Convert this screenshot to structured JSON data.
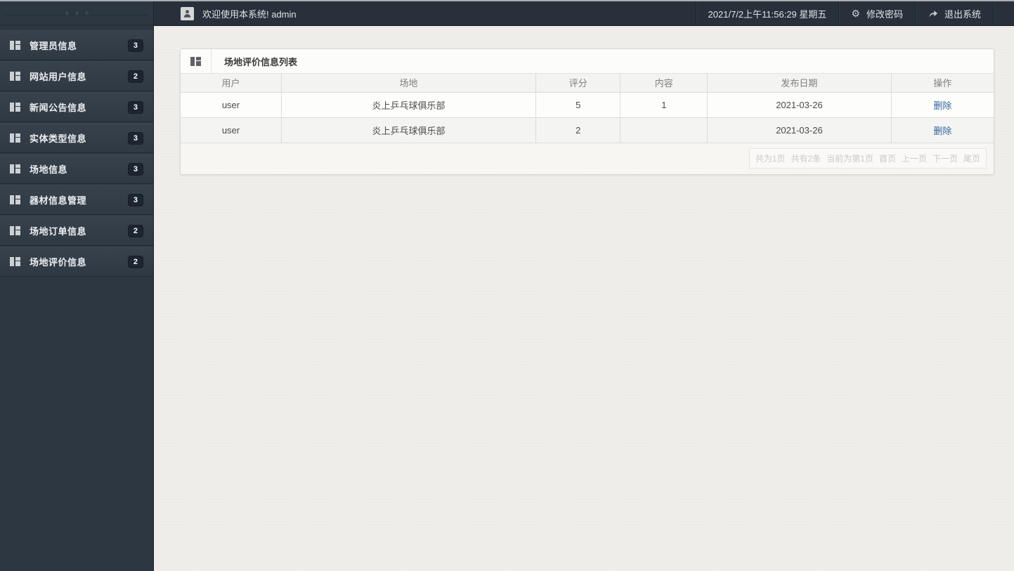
{
  "header": {
    "welcome": "欢迎使用本系统! admin",
    "datetime": "2021/7/2上午11:56:29 星期五",
    "change_password": "修改密码",
    "logout": "退出系统",
    "gear_glyph": "⚙"
  },
  "sidebar": {
    "items": [
      {
        "label": "管理员信息",
        "badge": "3"
      },
      {
        "label": "网站用户信息",
        "badge": "2"
      },
      {
        "label": "新闻公告信息",
        "badge": "3"
      },
      {
        "label": "实体类型信息",
        "badge": "3"
      },
      {
        "label": "场地信息",
        "badge": "3"
      },
      {
        "label": "器材信息管理",
        "badge": "3"
      },
      {
        "label": "场地订单信息",
        "badge": "2"
      },
      {
        "label": "场地评价信息",
        "badge": "2"
      }
    ]
  },
  "panel": {
    "title": "场地评价信息列表",
    "table": {
      "columns": [
        "用户",
        "场地",
        "评分",
        "内容",
        "发布日期",
        "操作"
      ],
      "rows": [
        {
          "user": "user",
          "venue": "炎上乒乓球俱乐部",
          "score": "5",
          "content": "1",
          "date": "2021-03-26",
          "action": "删除"
        },
        {
          "user": "user",
          "venue": "炎上乒乓球俱乐部",
          "score": "2",
          "content": "",
          "date": "2021-03-26",
          "action": "删除"
        }
      ]
    },
    "pagination": {
      "total_pages": "共为1页",
      "total_records": "共有2条",
      "current": "当前为第1页",
      "first": "首页",
      "prev": "上一页",
      "next": "下一页",
      "last": "尾页"
    }
  },
  "colors": {
    "sidebar_bg": "#2d3741",
    "topbar_bg": "#28313b",
    "content_bg": "#f0eeeb",
    "badge_bg": "#1c2530",
    "link_accent": "#336699",
    "table_header_bg": "#f3f3f1",
    "pagination_text": "#c9c9c7"
  }
}
